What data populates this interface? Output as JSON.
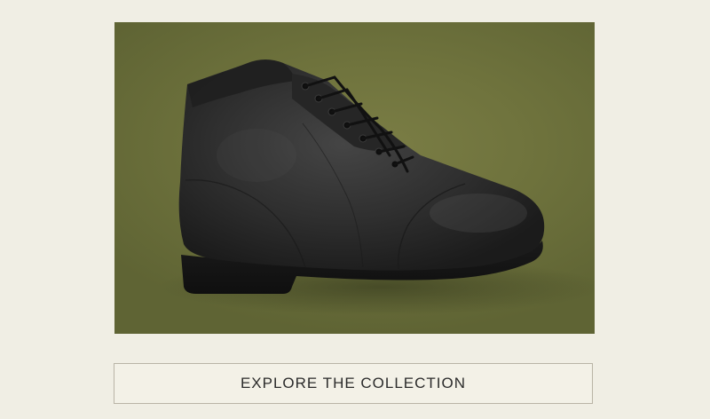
{
  "hero": {
    "image_subject": "black-leather-lace-up-boot",
    "background_color": "#6f733d",
    "boot_color": "#2c2c2c"
  },
  "cta": {
    "label": "EXPLORE THE COLLECTION"
  },
  "page": {
    "background_color": "#f0eee4"
  }
}
